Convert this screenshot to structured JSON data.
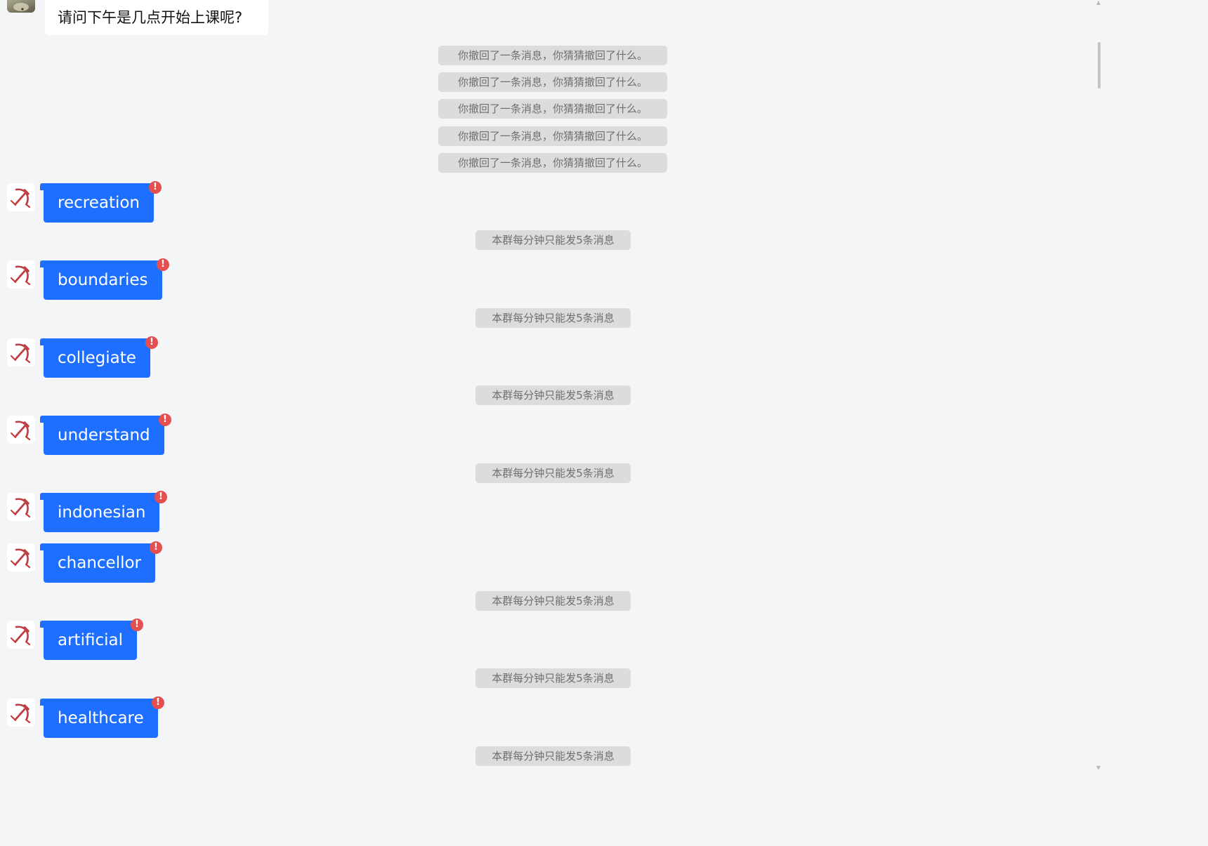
{
  "question": {
    "text": "请问下午是几点开始上课呢?"
  },
  "recall_notices": [
    "你撤回了一条消息，你猜猜撤回了什么。",
    "你撤回了一条消息，你猜猜撤回了什么。",
    "你撤回了一条消息，你猜猜撤回了什么。",
    "你撤回了一条消息，你猜猜撤回了什么。",
    "你撤回了一条消息，你猜猜撤回了什么。"
  ],
  "sent_messages": [
    "recreation",
    "boundaries",
    "collegiate",
    "understand",
    "indonesian",
    "chancellor",
    "artificial",
    "healthcare"
  ],
  "limit_notices": [
    "本群每分钟只能发5条消息",
    "本群每分钟只能发5条消息",
    "本群每分钟只能发5条消息",
    "本群每分钟只能发5条消息",
    "本群每分钟只能发5条消息",
    "本群每分钟只能发5条消息",
    "本群每分钟只能发5条消息"
  ],
  "send_failed_icon": "!",
  "avatar_icon": "hammer-and-sickle-icon",
  "colors": {
    "sent_bubble": "#1e6fff",
    "error_icon": "#e45050",
    "system_pill": "#dcdcdc",
    "background": "#f4f5f7"
  },
  "scrollbar": {
    "up_arrow": "▲",
    "down_arrow": "▼"
  }
}
